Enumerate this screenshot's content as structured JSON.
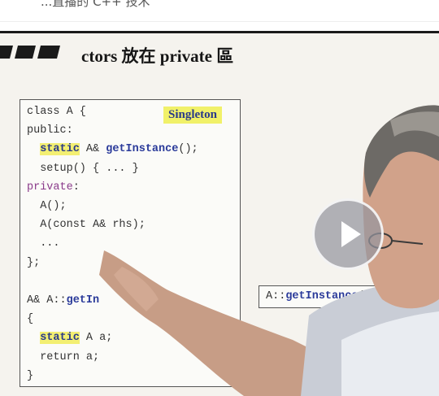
{
  "caption": {
    "text": "...直播的 C++ 技术"
  },
  "slide": {
    "title": "ctors 放在 private 區",
    "badge": "Singleton",
    "code_lines": [
      {
        "parts": [
          {
            "t": "class A {",
            "c": ""
          }
        ]
      },
      {
        "parts": [
          {
            "t": "public:",
            "c": ""
          }
        ]
      },
      {
        "parts": [
          {
            "t": "  ",
            "c": ""
          },
          {
            "t": "static",
            "c": "kw-hl"
          },
          {
            "t": " A& ",
            "c": ""
          },
          {
            "t": "getInstance",
            "c": "fn"
          },
          {
            "t": "();",
            "c": ""
          }
        ]
      },
      {
        "parts": [
          {
            "t": "  setup() { ... }",
            "c": ""
          }
        ]
      },
      {
        "parts": [
          {
            "t": "private",
            "c": "priv"
          },
          {
            "t": ":",
            "c": ""
          }
        ]
      },
      {
        "parts": [
          {
            "t": "  A();",
            "c": ""
          }
        ]
      },
      {
        "parts": [
          {
            "t": "  A(const A& rhs);",
            "c": ""
          }
        ]
      },
      {
        "parts": [
          {
            "t": "  ...",
            "c": ""
          }
        ]
      },
      {
        "parts": [
          {
            "t": "};",
            "c": ""
          }
        ]
      },
      {
        "parts": [
          {
            "t": "",
            "c": ""
          }
        ]
      },
      {
        "parts": [
          {
            "t": "A& A::",
            "c": ""
          },
          {
            "t": "getIn",
            "c": "fn"
          }
        ]
      },
      {
        "parts": [
          {
            "t": "{",
            "c": ""
          }
        ]
      },
      {
        "parts": [
          {
            "t": "  ",
            "c": ""
          },
          {
            "t": "static",
            "c": "kw-hl"
          },
          {
            "t": " A a;",
            "c": ""
          }
        ]
      },
      {
        "parts": [
          {
            "t": "  return a;",
            "c": ""
          }
        ]
      },
      {
        "parts": [
          {
            "t": "}",
            "c": ""
          }
        ]
      }
    ],
    "call_box": {
      "prefix": "A::",
      "fn": "getInstance",
      "suffix": "()."
    }
  },
  "player": {
    "play_icon": "play-icon"
  }
}
